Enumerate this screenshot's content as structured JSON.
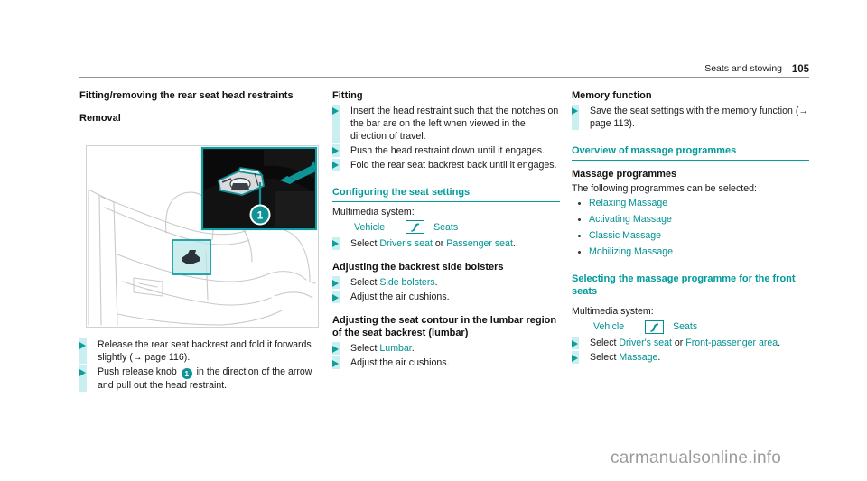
{
  "header": {
    "section_title": "Seats and stowing",
    "page_number": "105"
  },
  "watermark": "carmanualsonline.info",
  "colors": {
    "teal": "#00918f",
    "teal_heading": "#009a9a",
    "bullet_bar": "#caeff0",
    "bullet_triangle": "#0f9c9c"
  },
  "left_column": {
    "heading": "Fitting/removing the rear seat head restraints",
    "subheading": "Removal",
    "figure": {
      "name": "rear-seat-head-restraint-illustration",
      "callout_number": "1",
      "description": "Line drawing of rear seat with inset photo of the release knob"
    },
    "steps": [
      "Release the rear seat backrest and fold it forwards slightly (→ page 116).",
      "Push release knob ➀ in the direction of the arrow and pull out the head restraint."
    ],
    "step2_before": "Push release knob",
    "step2_knob": "1",
    "step2_after": "in the direction of the arrow and pull out the head restraint."
  },
  "middle_column": {
    "fitting_heading": "Fitting",
    "fitting_steps": [
      "Insert the head restraint such that the notches on the bar are on the left when viewed in the direction of travel.",
      "Push the head restraint down until it engages.",
      "Fold the rear seat backrest back until it engages."
    ],
    "config_heading": "Configuring the seat settings",
    "multimedia_label": "Multimedia system:",
    "menu_vehicle": "Vehicle",
    "menu_seats": "Seats",
    "select_label": "Select",
    "select_drivers_seat": "Driver's seat",
    "select_or": "or",
    "select_passenger_seat": "Passenger seat",
    "bolsters_heading": "Adjusting the backrest side bolsters",
    "bolsters_select_target": "Side bolsters",
    "bolsters_step2": "Adjust the air cushions.",
    "lumbar_heading": "Adjusting the seat contour in the lumbar region of the seat backrest (lumbar)",
    "lumbar_select_target": "Lumbar",
    "lumbar_step2": "Adjust the air cushions."
  },
  "right_column": {
    "memory_heading": "Memory function",
    "memory_step": "Save the seat settings with the memory function (→ page 113).",
    "overview_heading": "Overview of massage programmes",
    "programmes_heading": "Massage programmes",
    "programmes_intro": "The following programmes can be selected:",
    "programmes": [
      "Relaxing Massage",
      "Activating Massage",
      "Classic Massage",
      "Mobilizing Massage"
    ],
    "selecting_heading": "Selecting the massage programme for the front seats",
    "multimedia_label": "Multimedia system:",
    "menu_vehicle": "Vehicle",
    "menu_seats": "Seats",
    "select_label": "Select",
    "select_drivers_seat": "Driver's seat",
    "select_or": "or",
    "select_front_passenger_area": "Front-passenger area",
    "select_massage": "Massage"
  }
}
